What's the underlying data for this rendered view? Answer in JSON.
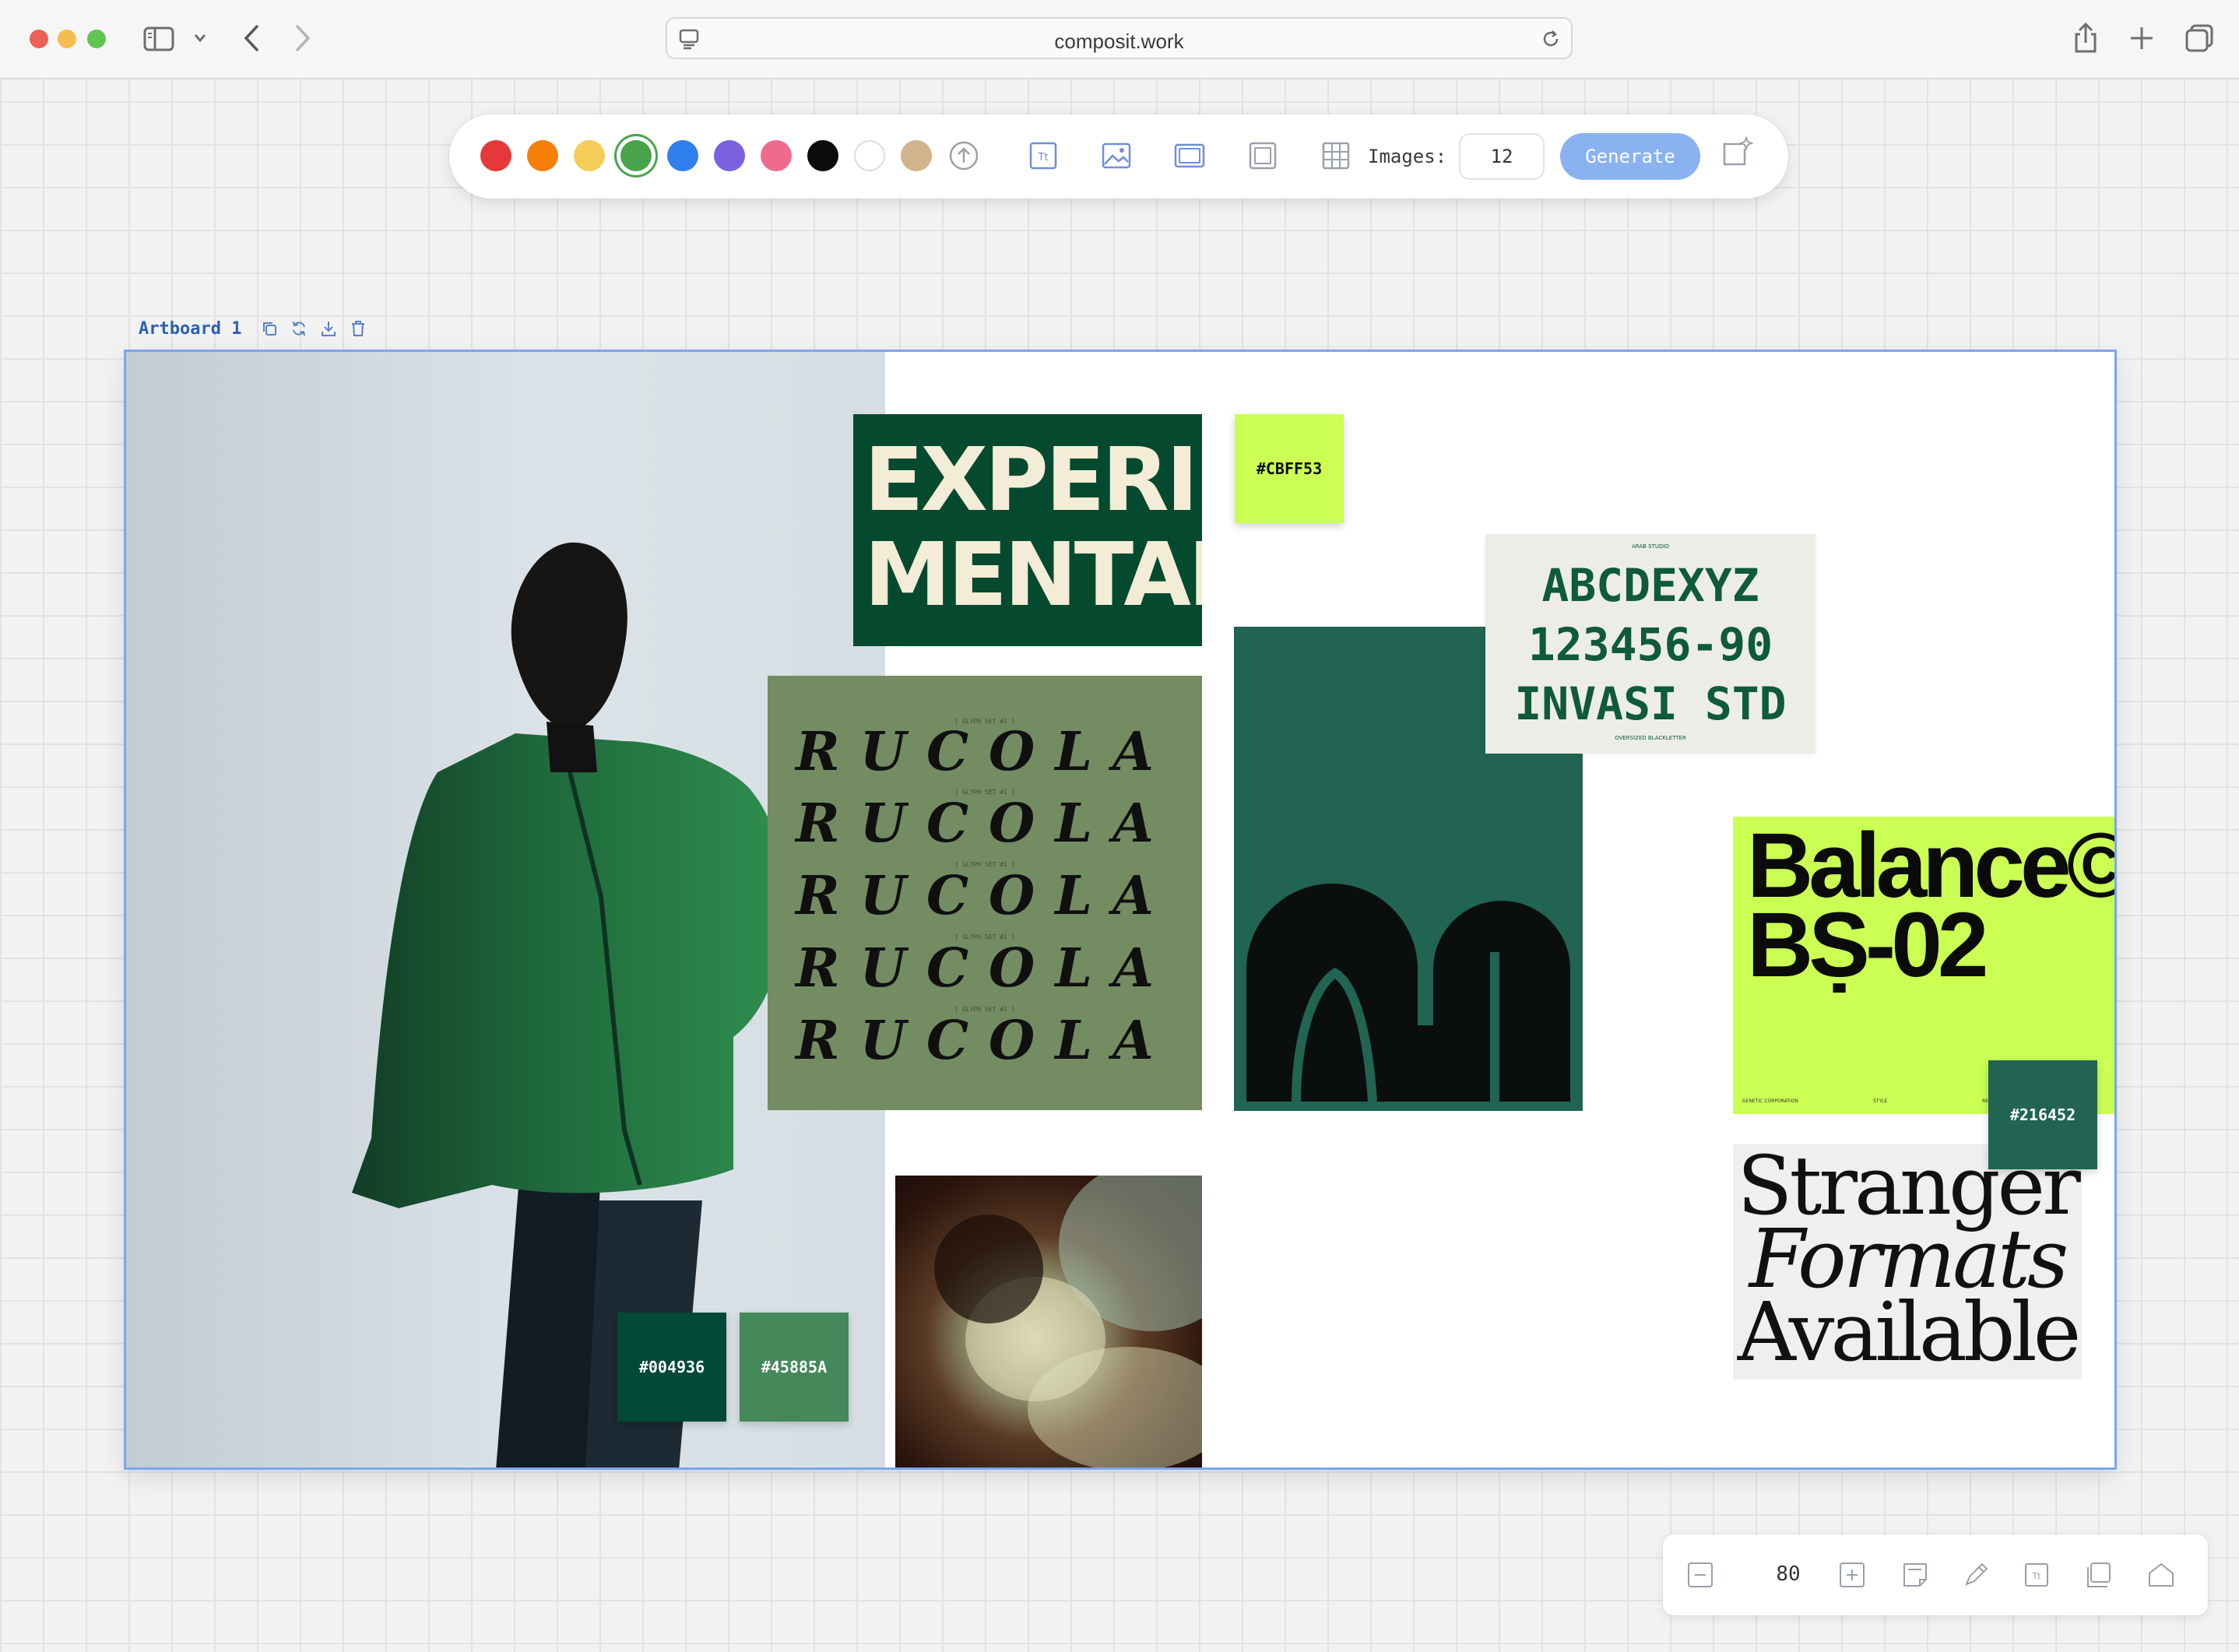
{
  "browser": {
    "url": "composit.work"
  },
  "toolbar": {
    "colors": [
      "#e5383b",
      "#f77f0a",
      "#f3cd58",
      "#4aa34c",
      "#2f80ed",
      "#7b61e0",
      "#f06a8f",
      "#0b0b0b",
      "#ffffff",
      "#d2b48c"
    ],
    "selected_color": "#4aa34c",
    "images_label": "Images:",
    "images_value": "12",
    "generate_label": "Generate"
  },
  "artboard": {
    "label": "Artboard 1",
    "board": {
      "experimental": {
        "line1": "EXPERI",
        "line2": "MENTAL",
        "bg": "#054a2e",
        "fg": "#f3ecd6"
      },
      "rucola": {
        "word": "RUCOLA",
        "caption": "[ GLYPH SET #1 ]",
        "bg": "#748c62"
      },
      "invasi": {
        "small": "ARAB STUDIO",
        "lines": [
          "ABCDEXYZ",
          "123456-90",
          "INVASI STD"
        ],
        "footer": "OVERSIZED BLACKLETTER",
        "bg": "#ecede6",
        "fg": "#0f5a3a"
      },
      "balance": {
        "line1": "Balance©",
        "line2": "BṢ-02",
        "bg": "#cbff53",
        "foot": [
          "GENETIC CORPORATION",
          "STYLE",
          "RELEASED"
        ]
      },
      "stranger": {
        "lines": [
          "Stranger",
          "Formats",
          "Available"
        ],
        "bg": "#efefef"
      },
      "chips": [
        {
          "hex": "#CBFF53",
          "bg": "#cbff53",
          "fg": "#0a0a0a"
        },
        {
          "hex": "#216452",
          "bg": "#216452",
          "fg": "#ffffff"
        },
        {
          "hex": "#004936",
          "bg": "#004936",
          "fg": "#ffffff"
        },
        {
          "hex": "#45885A",
          "bg": "#45885a",
          "fg": "#ffffff"
        }
      ]
    }
  },
  "bottombar": {
    "zoom": "80"
  }
}
